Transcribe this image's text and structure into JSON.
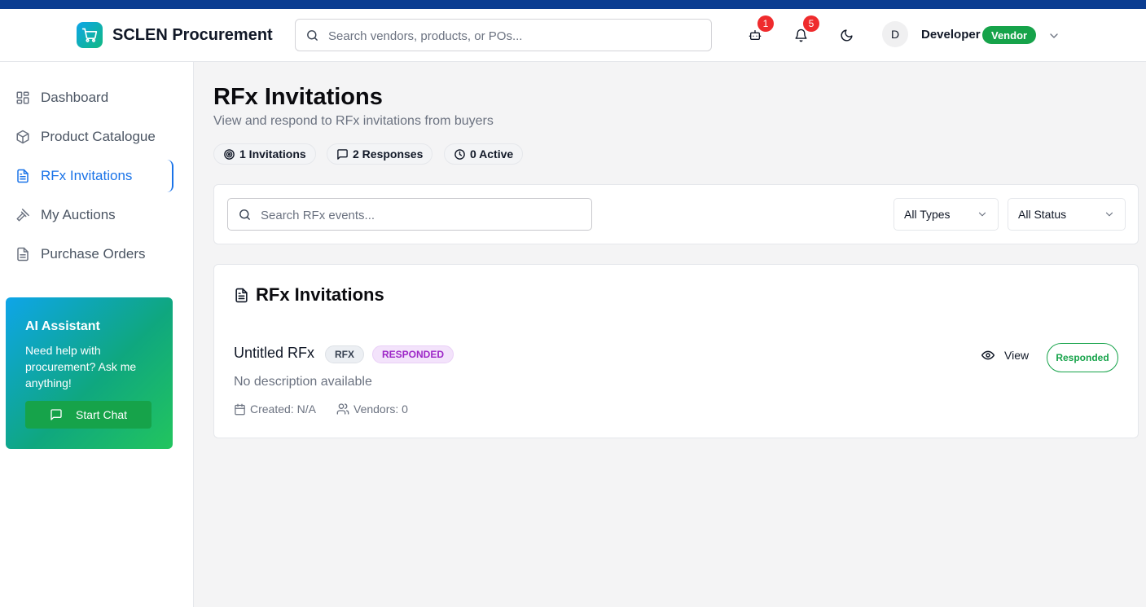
{
  "header": {
    "brand": "SCLEN Procurement",
    "search_placeholder": "Search vendors, products, or POs...",
    "ai_badge": "1",
    "notification_badge": "5",
    "avatar_initial": "D",
    "user_name": "Developer",
    "user_role": "Vendor",
    "icons": [
      "cart-icon",
      "search-icon",
      "robot-icon",
      "bell-icon",
      "moon-icon",
      "chevron-down-icon"
    ],
    "colors": {
      "top_strip": "#0b3d91",
      "role_badge": "#16a34a",
      "notification": "#ef2b2d"
    }
  },
  "sidebar": {
    "items": [
      {
        "label": "Dashboard",
        "icon": "dashboard-icon"
      },
      {
        "label": "Product Catalogue",
        "icon": "box-icon"
      },
      {
        "label": "RFx Invitations",
        "icon": "document-icon",
        "active": true
      },
      {
        "label": "My Auctions",
        "icon": "gavel-icon"
      },
      {
        "label": "Purchase Orders",
        "icon": "file-icon"
      }
    ],
    "ai_card": {
      "title": "AI Assistant",
      "text": "Need help with procurement? Ask me anything!",
      "button": "Start Chat"
    },
    "accent": "#1a73e8"
  },
  "page": {
    "title": "RFx Invitations",
    "subtitle": "View and respond to RFx invitations from buyers",
    "stats": [
      {
        "label": "1 Invitations",
        "icon": "target-icon"
      },
      {
        "label": "2 Responses",
        "icon": "message-icon"
      },
      {
        "label": "0 Active",
        "icon": "clock-icon"
      }
    ]
  },
  "filters": {
    "search_placeholder": "Search RFx events...",
    "type_select": "All Types",
    "status_select": "All Status"
  },
  "list": {
    "title": "RFx Invitations",
    "items": [
      {
        "name": "Untitled RFx",
        "type": "RFX",
        "status": "RESPONDED",
        "description": "No description available",
        "created": "Created: N/A",
        "vendors": "Vendors: 0",
        "view_label": "View",
        "action_label": "Responded"
      }
    ]
  }
}
